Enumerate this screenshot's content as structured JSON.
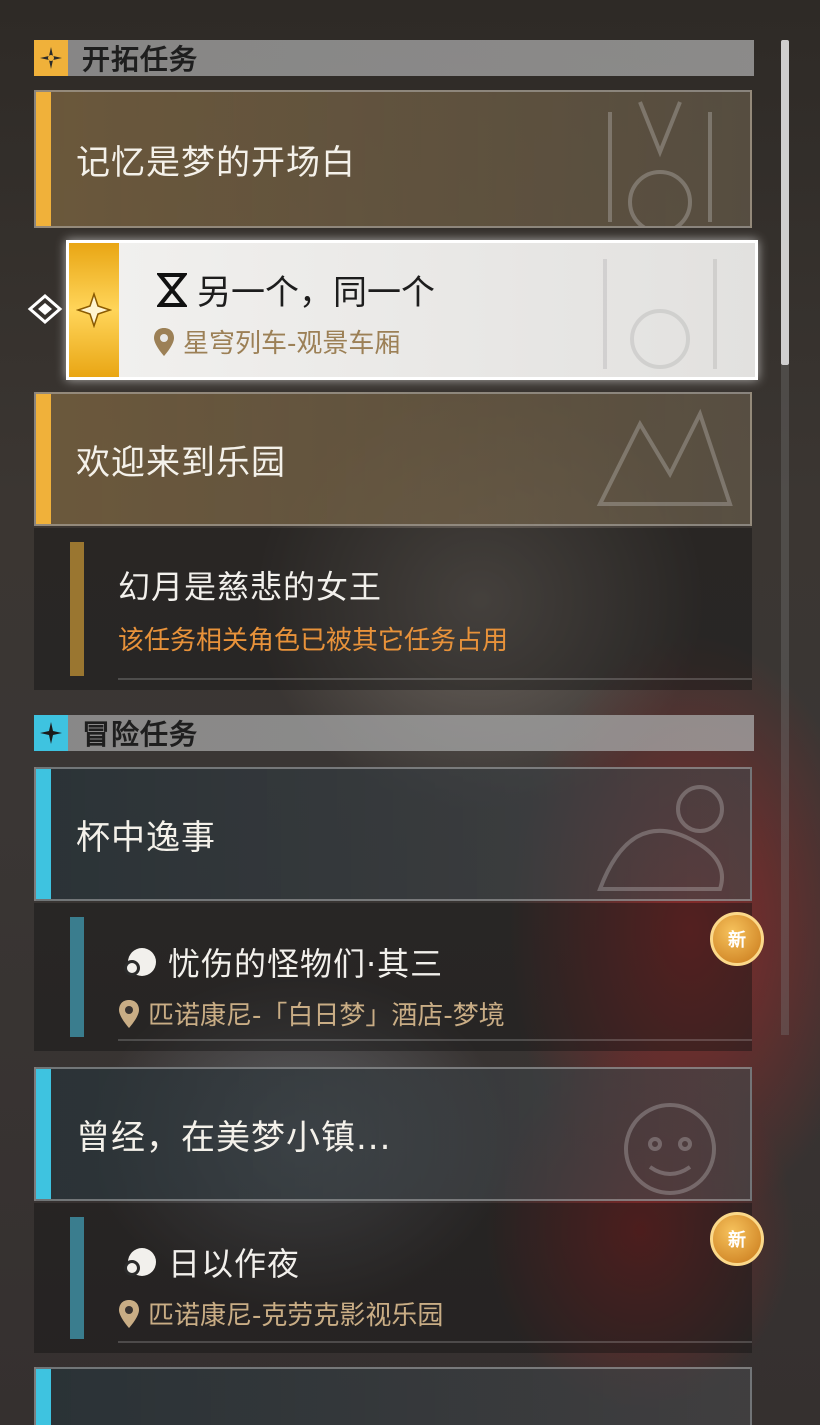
{
  "sections": {
    "trailblaze": {
      "title": "开拓任务",
      "accent": "#f0b13a"
    },
    "adventure": {
      "title": "冒险任务",
      "accent": "#3ec3e0"
    }
  },
  "trailblaze_quests": {
    "memory": {
      "title": "记忆是梦的开场白"
    },
    "selected": {
      "title": "另一个，同一个",
      "location": "星穹列车-观景车厢"
    },
    "welcome": {
      "title": "欢迎来到乐园"
    },
    "moon": {
      "title": "幻月是慈悲的女王",
      "status": "该任务相关角色已被其它任务占用"
    }
  },
  "adventure_quests": {
    "cup": {
      "title": "杯中逸事"
    },
    "monsters": {
      "title": "忧伤的怪物们·其三",
      "location": "匹诺康尼-「白日梦」酒店-梦境",
      "badge": "新"
    },
    "dreamtown": {
      "title": "曾经，在美梦小镇..."
    },
    "daynight": {
      "title": "日以作夜",
      "location": "匹诺康尼-克劳克影视乐园",
      "badge": "新"
    }
  },
  "icons": {
    "trailblaze_section": "compass-star-icon",
    "adventure_section": "four-point-star-icon",
    "selected_quest_type": "hourglass-icon",
    "adventure_quest_type": "leaf-swirl-icon",
    "location": "map-pin-icon",
    "pointer": "diamond-pointer-icon"
  }
}
